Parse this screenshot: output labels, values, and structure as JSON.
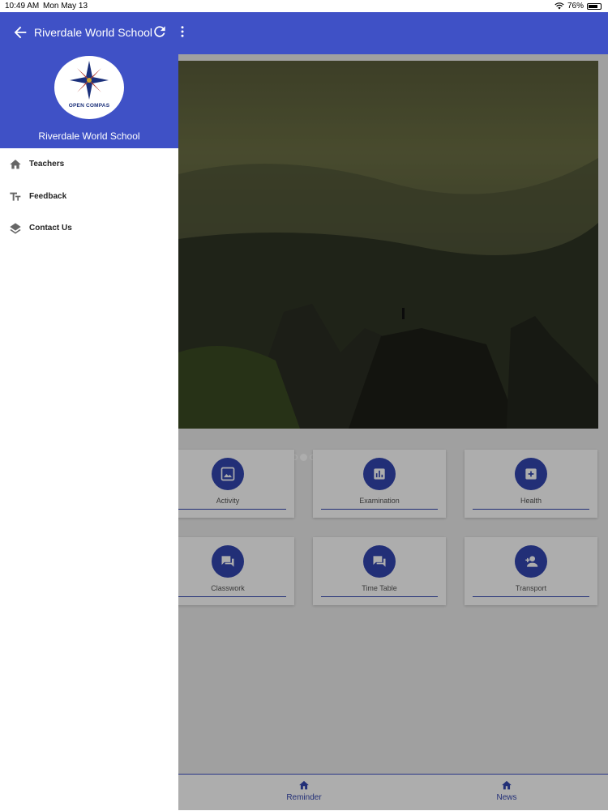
{
  "status_bar": {
    "time": "10:49 AM",
    "date": "Mon May 13",
    "battery": "76%"
  },
  "app_bar": {
    "title": "Riverdale World School"
  },
  "drawer": {
    "title": "Riverdale World School",
    "logo_text": "OPEN COMPAS",
    "items": [
      {
        "label": "Teachers",
        "icon": "home-icon"
      },
      {
        "label": "Feedback",
        "icon": "text-size-icon"
      },
      {
        "label": "Contact Us",
        "icon": "layers-icon"
      }
    ]
  },
  "carousel": {
    "total": 3,
    "active": 2
  },
  "tiles": [
    {
      "label": "Activity",
      "icon": "image-icon"
    },
    {
      "label": "Examination",
      "icon": "bar-chart-icon"
    },
    {
      "label": "Health",
      "icon": "plus-box-icon"
    },
    {
      "label": "Classwork",
      "icon": "forum-icon"
    },
    {
      "label": "Time Table",
      "icon": "forum-icon"
    },
    {
      "label": "Transport",
      "icon": "person-add-icon"
    }
  ],
  "bottom_nav": [
    {
      "label": "Reminder",
      "icon": "home-icon"
    },
    {
      "label": "News",
      "icon": "home-icon"
    }
  ],
  "colors": {
    "primary": "#3f51c6",
    "icon_circle": "#3346b0",
    "scrim": "rgba(0,0,0,0.32)"
  }
}
